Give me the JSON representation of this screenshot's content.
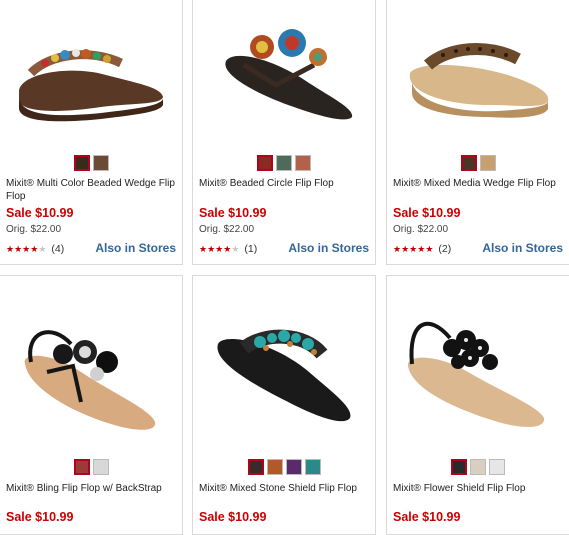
{
  "products": [
    {
      "name": "Mixit® Multi Color Beaded Wedge Flip Flop",
      "sale_price": "Sale $10.99",
      "orig_price": "Orig. $22.00",
      "rating": 4,
      "rating_max": 5,
      "review_count": "(4)",
      "stores_label": "Also in Stores",
      "swatches": [
        "#3a2a1e",
        "#6b4a36"
      ],
      "selected_swatch": 0,
      "image_icon": "brown-wedge-sandal"
    },
    {
      "name": "Mixit® Beaded Circle Flip Flop",
      "sale_price": "Sale $10.99",
      "orig_price": "Orig. $22.00",
      "rating": 4,
      "rating_max": 5,
      "review_count": "(1)",
      "stores_label": "Also in Stores",
      "swatches": [
        "#8a2a24",
        "#4d6a5a",
        "#b0624a"
      ],
      "selected_swatch": 0,
      "image_icon": "black-beaded-circle-sandal"
    },
    {
      "name": "Mixit® Mixed Media Wedge Flip Flop",
      "sale_price": "Sale $10.99",
      "orig_price": "Orig. $22.00",
      "rating": 5,
      "rating_max": 5,
      "review_count": "(2)",
      "stores_label": "Also in Stores",
      "swatches": [
        "#4a3526",
        "#c8a070"
      ],
      "selected_swatch": 0,
      "image_icon": "leopard-wedge-sandal"
    },
    {
      "name": "Mixit® Bling Flip Flop w/ BackStrap",
      "sale_price": "Sale $10.99",
      "swatches": [
        "#9a3a3a",
        "#d8d8d8"
      ],
      "selected_swatch": 0,
      "image_icon": "black-bling-sandal"
    },
    {
      "name": "Mixit® Mixed Stone Shield Flip Flop",
      "sale_price": "Sale $10.99",
      "swatches": [
        "#3a2a2a",
        "#b05a2a",
        "#5a2a6a",
        "#2a8a8a"
      ],
      "selected_swatch": 0,
      "image_icon": "turquoise-stone-sandal"
    },
    {
      "name": "Mixit® Flower Shield Flip Flop",
      "sale_price": "Sale $10.99",
      "swatches": [
        "#2a2a2a",
        "#d8cfc0",
        "#e6e6e6"
      ],
      "selected_swatch": 0,
      "image_icon": "black-flower-sandal"
    }
  ],
  "colors": {
    "sale": "#cc0000",
    "link": "#336699",
    "star_on": "#c00000",
    "star_off": "#c8c8c8",
    "selected_border": "#b3001b"
  },
  "icons": {
    "star": "★"
  }
}
